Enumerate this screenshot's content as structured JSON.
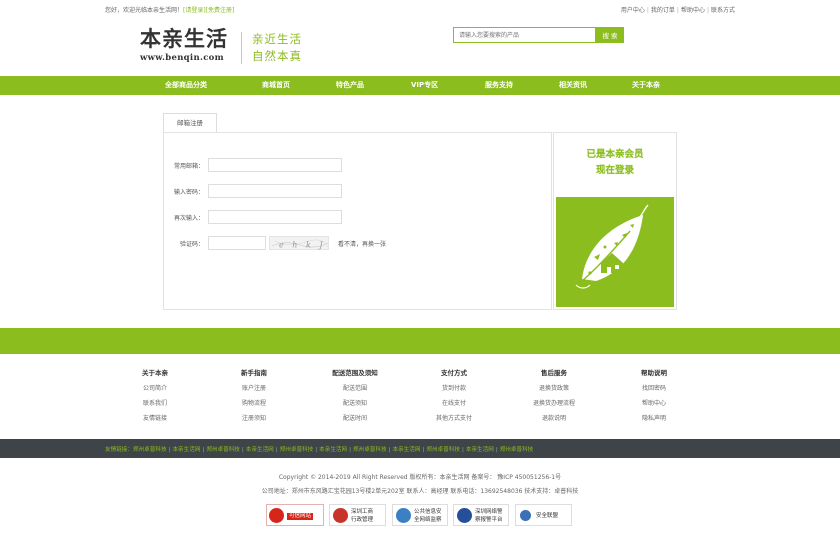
{
  "topbar": {
    "welcome": "您好，欢迎光临本亲生活网！",
    "login": "[请登录]",
    "register": "[免费注册]",
    "links": [
      "用户中心",
      "我的订单",
      "帮助中心",
      "联系方式"
    ]
  },
  "logo": {
    "cn": "本亲生活",
    "en": "www.benqin.com"
  },
  "slogan": {
    "line1": "亲近生活",
    "line2": "自然本真"
  },
  "search": {
    "placeholder": "请输入您要搜索的产品",
    "button": "搜 索"
  },
  "nav": {
    "items": [
      "全部商品分类",
      "商城首页",
      "特色产品",
      "VIP专区",
      "服务支持",
      "相关资讯",
      "关于本亲"
    ]
  },
  "form": {
    "tab": "邮箱注册",
    "email_label": "常用邮箱：",
    "password_label": "输入密码：",
    "confirm_label": "再次输入：",
    "captcha_label": "验证码：",
    "captcha_text": "e h k J",
    "refresh": "看不清，再换一张"
  },
  "member": {
    "line1": "已是本亲会员",
    "line2": "现在登录"
  },
  "footer": {
    "columns": [
      {
        "title": "关于本亲",
        "items": [
          "公司简介",
          "联系我们",
          "友情链接"
        ]
      },
      {
        "title": "新手指南",
        "items": [
          "账户注册",
          "购物流程",
          "注册须知"
        ]
      },
      {
        "title": "配送范围及须知",
        "items": [
          "配送范围",
          "配送须知",
          "配送时间"
        ]
      },
      {
        "title": "支付方式",
        "items": [
          "货到付款",
          "在线支付",
          "其他方式支付"
        ]
      },
      {
        "title": "售后服务",
        "items": [
          "退换货政策",
          "退换货办理流程",
          "退款说明"
        ]
      },
      {
        "title": "帮助说明",
        "items": [
          "找回密码",
          "帮助中心",
          "隐私声明"
        ]
      }
    ],
    "links_label": "友情链接：",
    "links": [
      "郑州卓普科技",
      "本亲生活网",
      "郑州卓普科技",
      "本亲生活网",
      "郑州卓普科技",
      "本亲生活网",
      "郑州卓普科技",
      "本亲生活网",
      "郑州卓普科技",
      "本亲生活网",
      "郑州卓普科技"
    ],
    "copyright": "Copyright © 2014-2019 All Right Reserved 版权所有：本亲生活网 备案号： 豫ICP 450051256-1号",
    "address": "公司地址：郑州市东风路汇宝花园13号楼2单元202室 联系人：高经理 联系电话：13692548036 技术支持：卓普科技",
    "badges": [
      {
        "line1": "可信网站",
        "line2": "",
        "icon": "trusted-site-icon",
        "color": "#d8251b"
      },
      {
        "line1": "深圳工商",
        "line2": "行政管理",
        "icon": "police-badge-icon",
        "color": "#c9342a"
      },
      {
        "line1": "公共信息安",
        "line2": "全网络监察",
        "icon": "shield-icon",
        "color": "#3b7fc4"
      },
      {
        "line1": "深圳网络警",
        "line2": "察报警平台",
        "icon": "police-icon",
        "color": "#264f9a"
      },
      {
        "line1": "安全联盟",
        "line2": "",
        "icon": "security-alliance-icon",
        "color": "#3b6fb6"
      }
    ]
  }
}
